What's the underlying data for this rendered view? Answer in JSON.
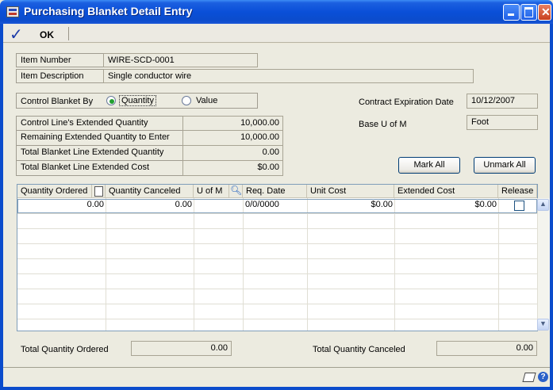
{
  "window": {
    "title": "Purchasing Blanket Detail Entry"
  },
  "toolbar": {
    "ok_label": "OK"
  },
  "item": {
    "number_label": "Item Number",
    "number_value": "WIRE-SCD-0001",
    "description_label": "Item Description",
    "description_value": "Single conductor wire"
  },
  "control": {
    "label": "Control Blanket By",
    "options": [
      "Quantity",
      "Value"
    ],
    "selected": "Quantity"
  },
  "contract": {
    "expiration_label": "Contract Expiration Date",
    "expiration_value": "10/12/2007",
    "uom_label": "Base U of M",
    "uom_value": "Foot"
  },
  "totals": [
    {
      "label": "Control Line's Extended Quantity",
      "value": "10,000.00"
    },
    {
      "label": "Remaining Extended Quantity to Enter",
      "value": "10,000.00"
    },
    {
      "label": "Total Blanket Line Extended Quantity",
      "value": "0.00"
    },
    {
      "label": "Total Blanket Line Extended Cost",
      "value": "$0.00"
    }
  ],
  "buttons": {
    "mark_all": "Mark All",
    "unmark_all": "Unmark All"
  },
  "grid": {
    "columns": [
      "Quantity Ordered",
      "Quantity Canceled",
      "U of M",
      "Req. Date",
      "Unit Cost",
      "Extended Cost",
      "Release"
    ],
    "rows": [
      {
        "quantity_ordered": "0.00",
        "quantity_canceled": "0.00",
        "uom": "",
        "req_date": "0/0/0000",
        "unit_cost": "$0.00",
        "extended_cost": "$0.00",
        "release": false
      }
    ]
  },
  "footer": {
    "total_ordered_label": "Total Quantity Ordered",
    "total_ordered_value": "0.00",
    "total_canceled_label": "Total Quantity Canceled",
    "total_canceled_value": "0.00"
  }
}
